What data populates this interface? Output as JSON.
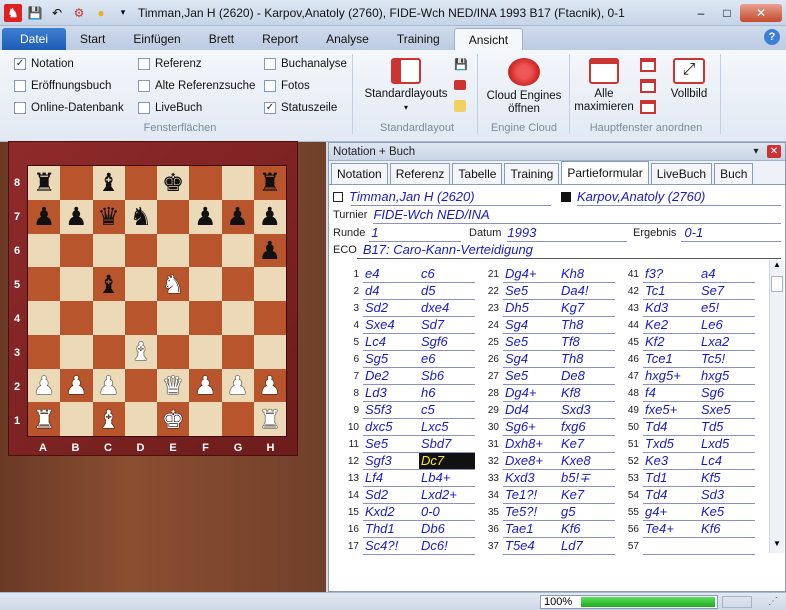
{
  "window": {
    "title": "Timman,Jan H (2620) - Karpov,Anatoly (2760), FIDE-Wch NED/INA 1993  B17  (Ftacnik), 0-1",
    "minimize": "–",
    "maximize": "□",
    "close": "✕"
  },
  "ribbon_tabs": [
    "Datei",
    "Start",
    "Einfügen",
    "Brett",
    "Report",
    "Analyse",
    "Training",
    "Ansicht"
  ],
  "active_ribbon_tab": "Ansicht",
  "ribbon": {
    "checkboxes": [
      {
        "label": "Notation",
        "checked": true
      },
      {
        "label": "Eröffnungsbuch",
        "checked": false
      },
      {
        "label": "Online-Datenbank",
        "checked": false
      },
      {
        "label": "Referenz",
        "checked": false
      },
      {
        "label": "Alte Referenzsuche",
        "checked": false
      },
      {
        "label": "LiveBuch",
        "checked": false
      },
      {
        "label": "Buchanalyse",
        "checked": false
      },
      {
        "label": "Fotos",
        "checked": false
      },
      {
        "label": "Statuszeile",
        "checked": true
      }
    ],
    "group_fensterflaechen": "Fensterflächen",
    "standardlayouts_label": "Standardlayouts",
    "group_standardlayout": "Standardlayout",
    "cloud_label_1": "Cloud Engines",
    "cloud_label_2": "öffnen",
    "group_engine_cloud": "Engine Cloud",
    "alle_label_1": "Alle",
    "alle_label_2": "maximieren",
    "vollbild_label": "Vollbild",
    "group_hauptfenster": "Hauptfenster anordnen"
  },
  "board": {
    "ranks": [
      "8",
      "7",
      "6",
      "5",
      "4",
      "3",
      "2",
      "1"
    ],
    "files": [
      "A",
      "B",
      "C",
      "D",
      "E",
      "F",
      "G",
      "H"
    ],
    "rows": [
      [
        "br",
        "",
        "bb",
        "",
        "bk",
        "",
        "",
        "br"
      ],
      [
        "bp",
        "bp",
        "bq",
        "bn",
        "",
        "bp",
        "bp",
        "bp"
      ],
      [
        "",
        "",
        "",
        "",
        "",
        "",
        "",
        "bp"
      ],
      [
        "",
        "",
        "bb",
        "",
        "wn",
        "",
        "",
        ""
      ],
      [
        "",
        "",
        "",
        "",
        "",
        "",
        "",
        ""
      ],
      [
        "",
        "",
        "",
        "wb",
        "",
        "",
        "",
        ""
      ],
      [
        "wp",
        "wp",
        "wp",
        "",
        "wq",
        "wp",
        "wp",
        "wp"
      ],
      [
        "wr",
        "",
        "wb",
        "",
        "wk",
        "",
        "",
        "wr"
      ]
    ]
  },
  "panel": {
    "title": "Notation + Buch",
    "tabs": [
      "Notation",
      "Referenz",
      "Tabelle",
      "Training",
      "Partieformular",
      "LiveBuch",
      "Buch"
    ],
    "active_tab": "Partieformular",
    "white_player": "Timman,Jan H (2620)",
    "black_player": "Karpov,Anatoly (2760)",
    "turnier_label": "Turnier",
    "turnier": "FIDE-Wch NED/INA",
    "runde_label": "Runde",
    "runde": "1",
    "datum_label": "Datum",
    "datum": "1993",
    "ergebnis_label": "Ergebnis",
    "ergebnis": "0-1",
    "eco_label": "ECO",
    "eco": "B17: Caro-Kann-Verteidigung"
  },
  "moves": [
    [
      "1",
      "e4",
      "c6"
    ],
    [
      "2",
      "d4",
      "d5"
    ],
    [
      "3",
      "Sd2",
      "dxe4"
    ],
    [
      "4",
      "Sxe4",
      "Sd7"
    ],
    [
      "5",
      "Lc4",
      "Sgf6"
    ],
    [
      "6",
      "Sg5",
      "e6"
    ],
    [
      "7",
      "De2",
      "Sb6"
    ],
    [
      "8",
      "Ld3",
      "h6"
    ],
    [
      "9",
      "S5f3",
      "c5"
    ],
    [
      "10",
      "dxc5",
      "Lxc5"
    ],
    [
      "11",
      "Se5",
      "Sbd7"
    ],
    [
      "12",
      "Sgf3",
      "Dc7"
    ],
    [
      "13",
      "Lf4",
      "Lb4+"
    ],
    [
      "14",
      "Sd2",
      "Lxd2+"
    ],
    [
      "15",
      "Kxd2",
      "0-0"
    ],
    [
      "16",
      "Thd1",
      "Db6"
    ],
    [
      "17",
      "Sc4?!",
      "Dc6!"
    ],
    [
      "21",
      "Dg4+",
      "Kh8"
    ],
    [
      "22",
      "Se5",
      "Da4!"
    ],
    [
      "23",
      "Dh5",
      "Kg7"
    ],
    [
      "24",
      "Sg4",
      "Th8"
    ],
    [
      "25",
      "Se5",
      "Tf8"
    ],
    [
      "26",
      "Sg4",
      "Th8"
    ],
    [
      "27",
      "Se5",
      "De8"
    ],
    [
      "28",
      "Dg4+",
      "Kf8"
    ],
    [
      "29",
      "Dd4",
      "Sxd3"
    ],
    [
      "30",
      "Sg6+",
      "fxg6"
    ],
    [
      "31",
      "Dxh8+",
      "Ke7"
    ],
    [
      "32",
      "Dxe8+",
      "Kxe8"
    ],
    [
      "33",
      "Kxd3",
      "b5!∓"
    ],
    [
      "34",
      "Te1?!",
      "Ke7"
    ],
    [
      "35",
      "Te5?!",
      "g5"
    ],
    [
      "36",
      "Tae1",
      "Kf6"
    ],
    [
      "37",
      "T5e4",
      "Ld7"
    ],
    [
      "41",
      "f3?",
      "a4"
    ],
    [
      "42",
      "Tc1",
      "Se7"
    ],
    [
      "43",
      "Kd3",
      "e5!"
    ],
    [
      "44",
      "Ke2",
      "Le6"
    ],
    [
      "45",
      "Kf2",
      "Lxa2"
    ],
    [
      "46",
      "Tce1",
      "Tc5!"
    ],
    [
      "47",
      "hxg5+",
      "hxg5"
    ],
    [
      "48",
      "f4",
      "Sg6"
    ],
    [
      "49",
      "fxe5+",
      "Sxe5"
    ],
    [
      "50",
      "Td4",
      "Td5"
    ],
    [
      "51",
      "Txd5",
      "Lxd5"
    ],
    [
      "52",
      "Ke3",
      "Lc4"
    ],
    [
      "53",
      "Td1",
      "Kf5"
    ],
    [
      "54",
      "Td4",
      "Sd3"
    ],
    [
      "55",
      "g4+",
      "Ke5"
    ],
    [
      "56",
      "Te4+",
      "Kf6"
    ],
    [
      "57",
      "",
      ""
    ]
  ],
  "highlighted_move": "Dc7",
  "status": {
    "progress_label": "100%",
    "progress_value": 1.0
  }
}
